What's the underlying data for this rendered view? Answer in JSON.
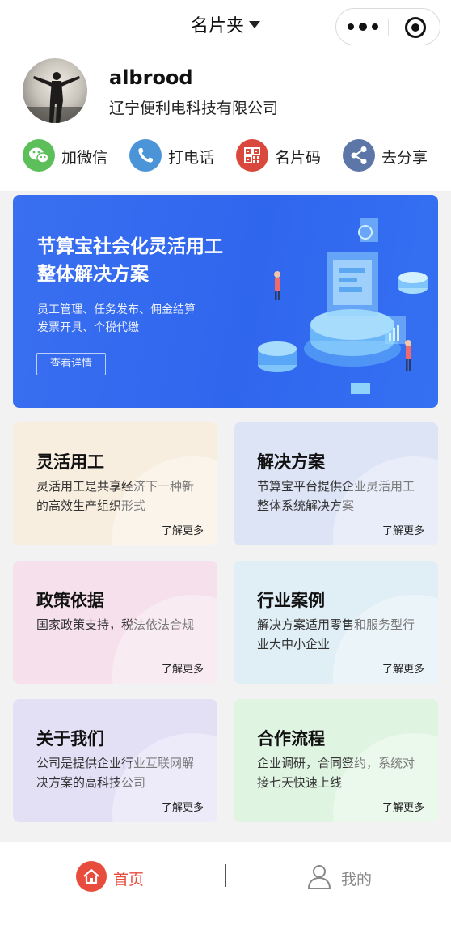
{
  "navbar": {
    "title": "名片夹"
  },
  "profile": {
    "name": "albrood",
    "company": "辽宁便利电科技有限公司"
  },
  "actions": [
    {
      "label": "加微信",
      "icon": "wechat-icon",
      "color": "#5cbf5a"
    },
    {
      "label": "打电话",
      "icon": "phone-icon",
      "color": "#4c94d8"
    },
    {
      "label": "名片码",
      "icon": "qrcode-icon",
      "color": "#d9473d"
    },
    {
      "label": "去分享",
      "icon": "share-icon",
      "color": "#5c76a8"
    }
  ],
  "banner": {
    "title_line1": "节算宝社会化灵活用工",
    "title_line2": "整体解决方案",
    "sub_line1": "员工管理、任务发布、佣金结算",
    "sub_line2": "发票开具、个税代缴",
    "button": "查看详情",
    "color": "#3368ee"
  },
  "cards": [
    {
      "title": "灵活用工",
      "desc": "灵活用工是共享经济下一种新的高效生产组织形式",
      "more": "了解更多",
      "color": "#f8eedf"
    },
    {
      "title": "解决方案",
      "desc": "节算宝平台提供企业灵活用工整体系统解决方案",
      "more": "了解更多",
      "color": "#dde4f6"
    },
    {
      "title": "政策依据",
      "desc": "国家政策支持，税法依法合规",
      "more": "了解更多",
      "color": "#f6e0eb"
    },
    {
      "title": "行业案例",
      "desc": "解决方案适用零售和服务型行业大中小企业",
      "more": "了解更多",
      "color": "#e0eef6"
    },
    {
      "title": "关于我们",
      "desc": "公司是提供企业行业互联网解决方案的高科技公司",
      "more": "了解更多",
      "color": "#e3e0f6"
    },
    {
      "title": "合作流程",
      "desc": "企业调研，合同签约，系统对接七天快速上线",
      "more": "了解更多",
      "color": "#e0f4e2"
    }
  ],
  "tabbar": {
    "home": {
      "label": "首页",
      "color": "#e84c3d",
      "icon": "home-icon"
    },
    "mine": {
      "label": "我的",
      "color": "#888888",
      "icon": "user-icon"
    }
  }
}
